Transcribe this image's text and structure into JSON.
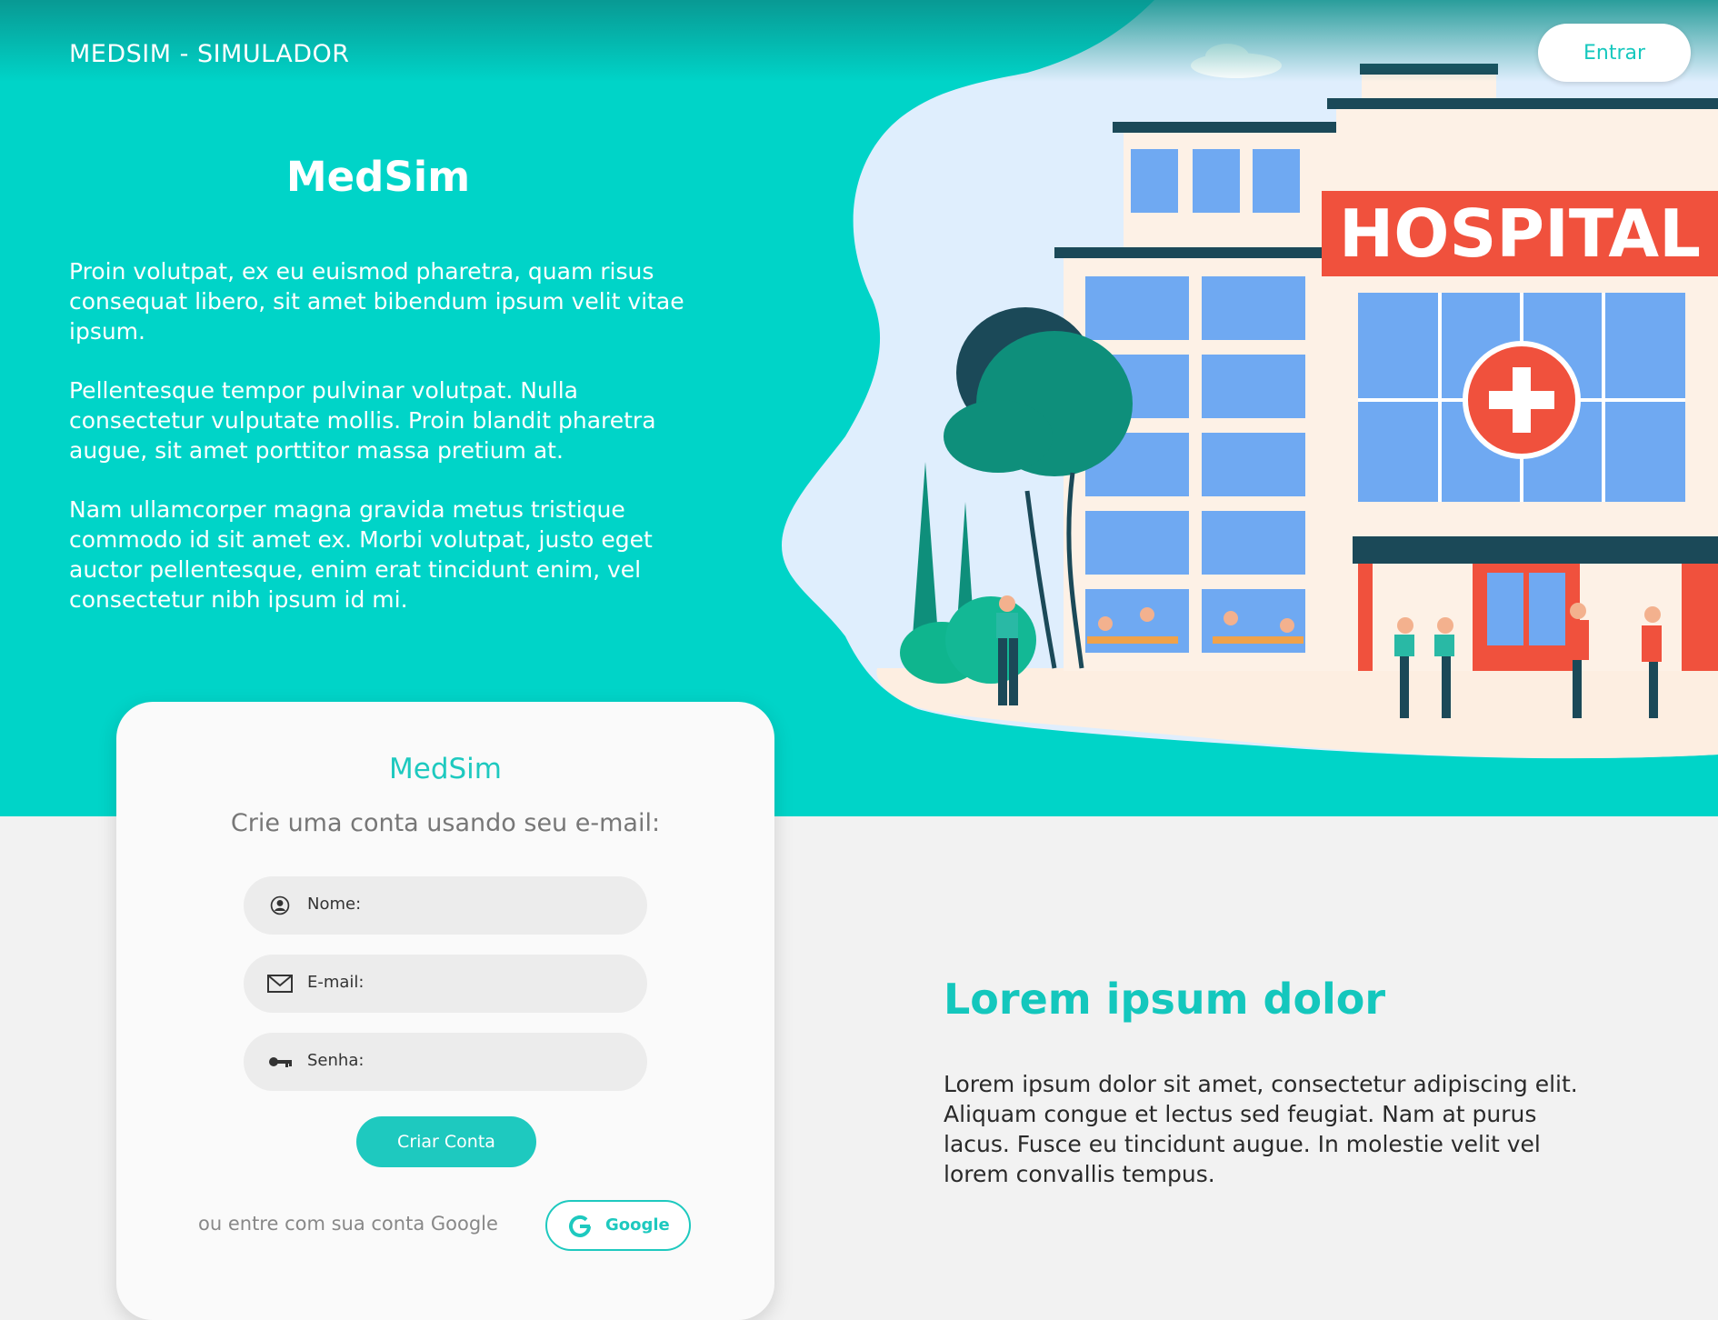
{
  "header": {
    "brand": "MEDSIM - SIMULADOR",
    "login_label": "Entrar"
  },
  "hero": {
    "title": "MedSim",
    "paragraphs": [
      "Proin volutpat, ex eu euismod pharetra, quam risus consequat libero, sit amet bibendum ipsum velit vitae ipsum.",
      "Pellentesque tempor pulvinar volutpat. Nulla consectetur vulputate mollis. Proin blandit pharetra augue, sit amet porttitor massa pretium at.",
      "Nam ullamcorper magna gravida metus tristique commodo id sit amet ex. Morbi volutpat, justo eget auctor pellentesque, enim erat tincidunt enim, vel consectetur nibh ipsum id mi."
    ],
    "illustration_sign": "HOSPITAL"
  },
  "signup": {
    "title": "MedSim",
    "subtitle": "Crie uma conta usando seu e-mail:",
    "fields": {
      "name": {
        "label": "Nome:",
        "icon": "user-circle-icon"
      },
      "email": {
        "label": "E-mail:",
        "icon": "envelope-icon"
      },
      "password": {
        "label": "Senha:",
        "icon": "key-icon"
      }
    },
    "submit_label": "Criar Conta",
    "google_prompt": "ou entre com sua conta Google",
    "google_label": "Google"
  },
  "section": {
    "title": "Lorem ipsum dolor",
    "text": "Lorem ipsum dolor sit amet, consectetur adipiscing elit. Aliquam congue et lectus sed feugiat. Nam at purus lacus. Fusce eu tincidunt augue. In molestie velit vel lorem convallis tempus."
  },
  "colors": {
    "accent": "#00d4c8",
    "accent_dark": "#1ec9bf",
    "hospital_red": "#f0513d",
    "background": "#f2f2f2"
  }
}
